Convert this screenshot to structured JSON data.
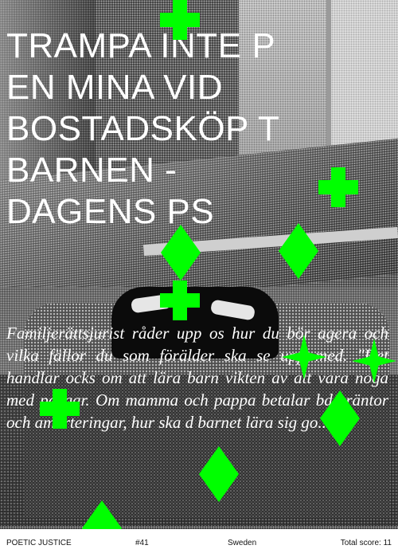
{
  "headline": "TRAMPA INTE P\nEN MINA VID\nBOSTADSKÖP T\nBARNEN -\nDAGENS PS",
  "body": "Familjerättsjurist råder upp os hur du bör agera och vilka fällor du som förälder ska se upp med. \"Det handlar ocks om att lära barn vikten av att vara noga med pengar. Om mamma och pappa betalar bde räntor och amorteringar, hur ska d barnet lära sig go...",
  "footer": {
    "brand": "POETIC JUSTICE",
    "number": "#41",
    "country": "Sweden",
    "score": "Total score: 11"
  },
  "colors": {
    "accent": "#00ff00",
    "text": "#ffffff",
    "footer_bg": "#ffffff"
  },
  "decorations": [
    "plus-icon",
    "diamond-icon",
    "star-icon"
  ]
}
